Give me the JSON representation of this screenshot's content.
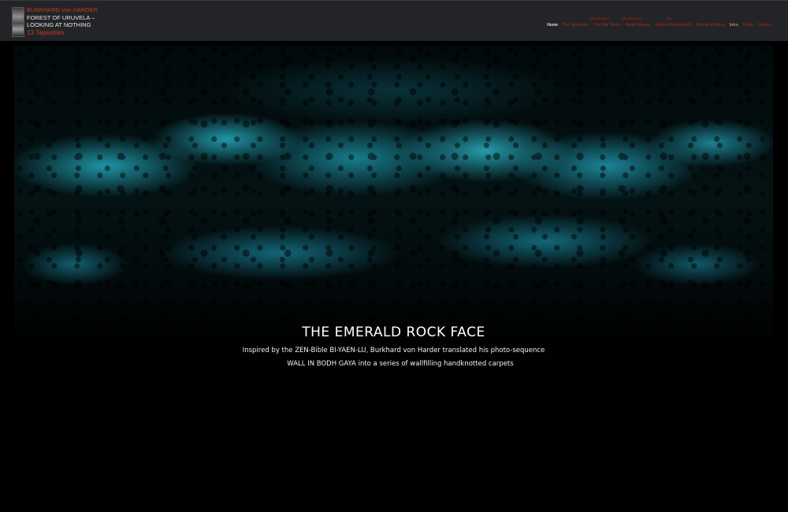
{
  "header": {
    "brand": {
      "artist": "BURKHARD von HARDER",
      "title_line_1": "FOREST OF URUVELA –",
      "title_line_2": "LOOKING AT NOTHING",
      "count": "13 Tapestries"
    },
    "nav": {
      "top_labels": [
        "Movement 1",
        "Movement 2",
        "Info"
      ],
      "items": [
        {
          "label": "Home",
          "state": "active"
        },
        {
          "label": "The Tapestries",
          "state": "normal"
        },
        {
          "label": "The Wall Series",
          "state": "normal"
        },
        {
          "label": "Burkh Fangen",
          "state": "normal"
        },
        {
          "label": "Galerie Dummerforth",
          "state": "normal"
        },
        {
          "label": "Bonner Knotting",
          "state": "normal"
        },
        {
          "label": "Intro",
          "state": "highlight"
        },
        {
          "label": "Order",
          "state": "normal"
        },
        {
          "label": "Contact",
          "state": "normal"
        }
      ]
    }
  },
  "hero": {
    "title": "THE EMERALD ROCK FACE",
    "line_1": "Inspired by the ZEN-Bible BI-YAEN-LU, Burkhard von Harder translated his photo-sequence",
    "line_2": "WALL IN BODH GAYA into a series of wallfilling handknotted carpets"
  },
  "colors": {
    "header_bg": "#232427",
    "accent_red": "#c8381f",
    "hero_teal": "#23aabe",
    "background": "#000000"
  }
}
